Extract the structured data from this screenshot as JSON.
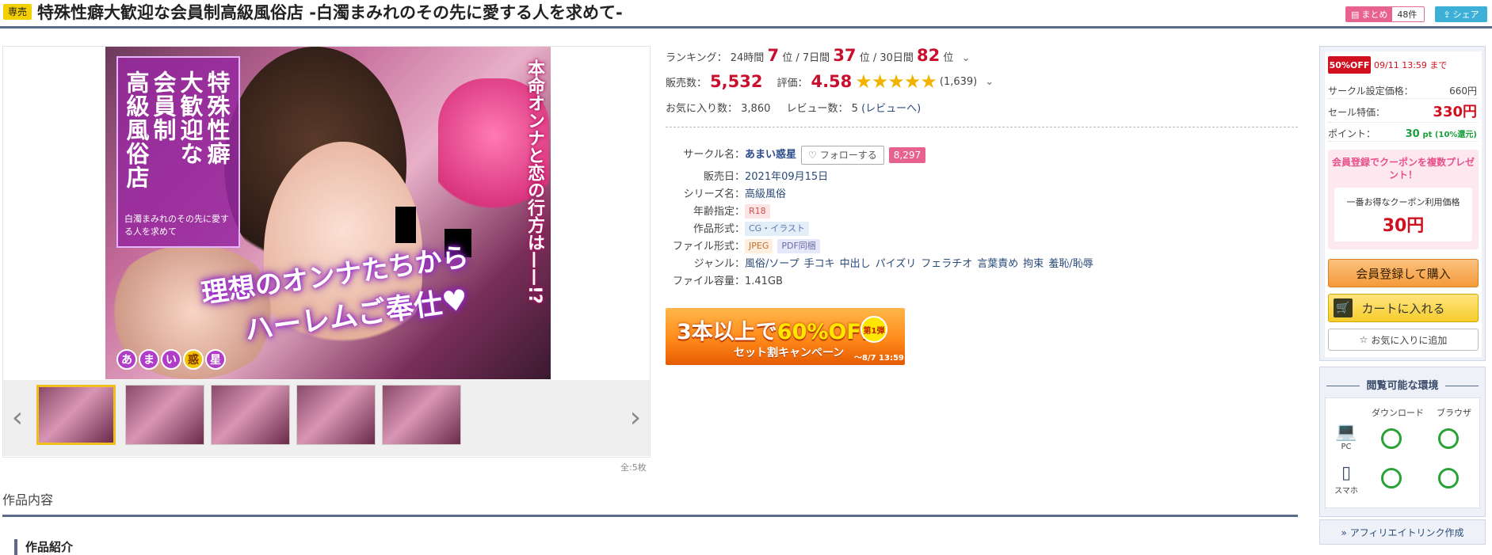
{
  "header": {
    "badge": "専売",
    "title": "特殊性癖大歓迎な会員制高級風俗店 -白濁まみれのその先に愛する人を求めて-",
    "matome_label": "まとめ",
    "matome_count": "48件",
    "share_label": "シェア"
  },
  "cover": {
    "title_lines": [
      "特殊",
      "大歓迎",
      "会員制",
      "高級風俗店"
    ],
    "title_cols": [
      "特殊性癖",
      "大歓迎な",
      "会員制",
      "高級風俗店"
    ],
    "subtitle": "白濁まみれのその先に愛する人を求めて",
    "side_text": "本命オンナと恋の行方は——!?",
    "catch_line1": "理想のオンナたちから",
    "catch_line2": "ハーレムご奉仕♥",
    "logo_chars": [
      "あ",
      "ま",
      "い",
      "惑",
      "星"
    ]
  },
  "gallery": {
    "thumb_count_label": "全:5枚",
    "thumbs": [
      "thumb-1",
      "thumb-2",
      "thumb-3",
      "thumb-4",
      "thumb-5"
    ]
  },
  "ranking": {
    "label": "ランキング：",
    "d24_label": "24時間",
    "d24_value": "7",
    "d7_label": "7日間",
    "d7_value": "37",
    "d30_label": "30日間",
    "d30_value": "82",
    "unit": "位"
  },
  "sales": {
    "label": "販売数：",
    "value": "5,532",
    "rating_label": "評価：",
    "rating_value": "4.58",
    "stars": "★★★★★",
    "rating_count": "(1,639)"
  },
  "favorites": {
    "fav_label": "お気に入り数：",
    "fav_value": "3,860",
    "review_label": "レビュー数：",
    "review_value": "5",
    "review_link": "(レビューへ)"
  },
  "spec": {
    "circle_key": "サークル名：",
    "circle_name": "あまい惑星",
    "follow_label": "フォローする",
    "follow_count": "8,297",
    "release_key": "販売日：",
    "release_value": "2021年09月15日",
    "series_key": "シリーズ名：",
    "series_value": "高級風俗",
    "age_key": "年齢指定：",
    "age_value": "R18",
    "format_key": "作品形式：",
    "format_value": "CG・イラスト",
    "file_key": "ファイル形式：",
    "file_values": [
      "JPEG",
      "PDF同梱"
    ],
    "genre_key": "ジャンル：",
    "genres": [
      "風俗/ソープ",
      "手コキ",
      "中出し",
      "パイズリ",
      "フェラチオ",
      "言葉責め",
      "拘束",
      "羞恥/恥辱"
    ],
    "size_key": "ファイル容量：",
    "size_value": "1.41GB"
  },
  "campaign": {
    "main_pre": "3本以上で",
    "main_big": "60%OFF!",
    "seal": "第1弾",
    "sub": "セット割キャンペーン",
    "date": "〜8/7 13:59"
  },
  "buy": {
    "sale_badge": "50%OFF",
    "sale_until": "09/11 13:59 まで",
    "list_price_label": "サークル設定価格：",
    "list_price": "660円",
    "sale_price_label": "セール特価：",
    "sale_price": "330円",
    "point_label": "ポイント：",
    "point_value": "30",
    "point_unit": "pt (10%還元)",
    "coupon_head": "会員登録でクーポンを複数プレゼント！",
    "coupon_label": "一番お得なクーポン利用価格",
    "coupon_price": "30円",
    "buy_label": "会員登録して購入",
    "cart_label": "カートに入れる",
    "fav_label": "お気に入りに追加"
  },
  "environment": {
    "title": "閲覧可能な環境",
    "col_download": "ダウンロード",
    "col_browser": "ブラウザ",
    "pc_label": "PC",
    "sp_label": "スマホ"
  },
  "affiliate_label": "» アフィリエイトリンク作成",
  "section": {
    "title": "作品内容",
    "intro": "作品紹介"
  },
  "colors": {
    "accent_red": "#c8102e",
    "navy": "#5a6a88",
    "pink": "#e8628f",
    "green_ok": "#2aa236"
  }
}
